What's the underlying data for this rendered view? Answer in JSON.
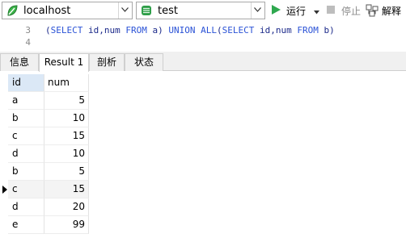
{
  "toolbar": {
    "connection": {
      "value": "localhost",
      "icon": "connection-leaf-icon"
    },
    "database": {
      "value": "test",
      "icon": "database-icon"
    },
    "run_label": "运行",
    "stop_label": "停止",
    "explain_label": "解释"
  },
  "editor": {
    "lines": [
      {
        "number": "3",
        "segments": [
          {
            "t": "(",
            "k": false
          },
          {
            "t": "SELECT",
            "k": true
          },
          {
            "t": " id,num ",
            "k": false
          },
          {
            "t": "FROM",
            "k": true
          },
          {
            "t": " a) ",
            "k": false
          },
          {
            "t": "UNION ALL",
            "k": true
          },
          {
            "t": "(",
            "k": false
          },
          {
            "t": "SELECT",
            "k": true
          },
          {
            "t": " id,num ",
            "k": false
          },
          {
            "t": "FROM",
            "k": true
          },
          {
            "t": " b)",
            "k": false
          }
        ]
      },
      {
        "number": "4",
        "segments": []
      }
    ]
  },
  "tabs": [
    {
      "label": "信息",
      "active": false
    },
    {
      "label": "Result 1",
      "active": true
    },
    {
      "label": "剖析",
      "active": false
    },
    {
      "label": "状态",
      "active": false
    }
  ],
  "grid": {
    "columns": [
      "id",
      "num"
    ],
    "rows": [
      [
        "a",
        "5"
      ],
      [
        "b",
        "10"
      ],
      [
        "c",
        "15"
      ],
      [
        "d",
        "10"
      ],
      [
        "b",
        "5"
      ],
      [
        "c",
        "15"
      ],
      [
        "d",
        "20"
      ],
      [
        "e",
        "99"
      ]
    ],
    "current_row": 5
  },
  "colors": {
    "accent_green": "#2fa84f",
    "keyword": "#2a52d6",
    "header_selected": "#dbe8f6"
  }
}
